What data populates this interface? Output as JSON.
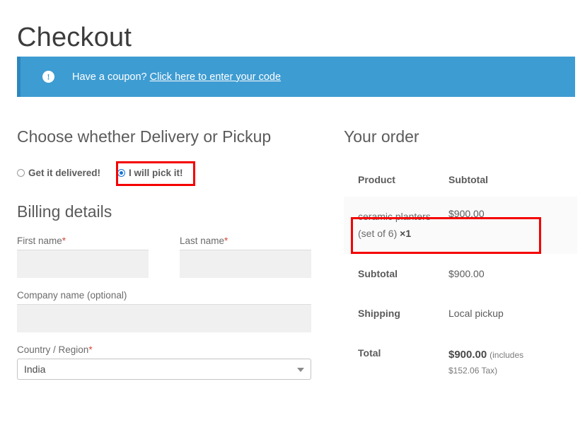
{
  "page": {
    "title": "Checkout"
  },
  "coupon": {
    "icon": "info-icon",
    "text": "Have a coupon?",
    "link_label": "Click here to enter your code"
  },
  "shipping_choice": {
    "heading": "Choose whether Delivery or Pickup",
    "options": [
      {
        "label": "Get it delivered!",
        "selected": false
      },
      {
        "label": "I will pick it!",
        "selected": true
      }
    ]
  },
  "billing": {
    "heading": "Billing details",
    "fields": {
      "first_name": {
        "label": "First name",
        "required_mark": "*",
        "value": "",
        "placeholder": ""
      },
      "last_name": {
        "label": "Last name",
        "required_mark": "*",
        "value": "",
        "placeholder": ""
      },
      "company": {
        "label": "Company name (optional)",
        "value": "",
        "placeholder": ""
      },
      "country": {
        "label": "Country / Region",
        "required_mark": "*",
        "value": "India"
      }
    }
  },
  "order": {
    "heading": "Your order",
    "columns": {
      "product": "Product",
      "subtotal": "Subtotal"
    },
    "items": [
      {
        "name": "ceramic planters (set of 6)",
        "qty_symbol": "×",
        "qty": "1",
        "subtotal": "$900.00"
      }
    ],
    "totals": [
      {
        "label": "Subtotal",
        "value": "$900.00"
      },
      {
        "label": "Shipping",
        "value": "Local pickup"
      }
    ],
    "total": {
      "label": "Total",
      "amount": "$900.00",
      "tax_prefix": "(includes",
      "tax_note": "$152.06 Tax)"
    }
  },
  "annotations": {
    "highlight_color": "#f50000",
    "boxes": [
      {
        "name": "pickup-option-highlight"
      },
      {
        "name": "shipping-row-highlight"
      }
    ]
  },
  "colors": {
    "banner_bg": "#3d9cd2",
    "banner_border": "#2e86bd",
    "radio_selected": "#1277d6",
    "required": "#d84a38"
  }
}
